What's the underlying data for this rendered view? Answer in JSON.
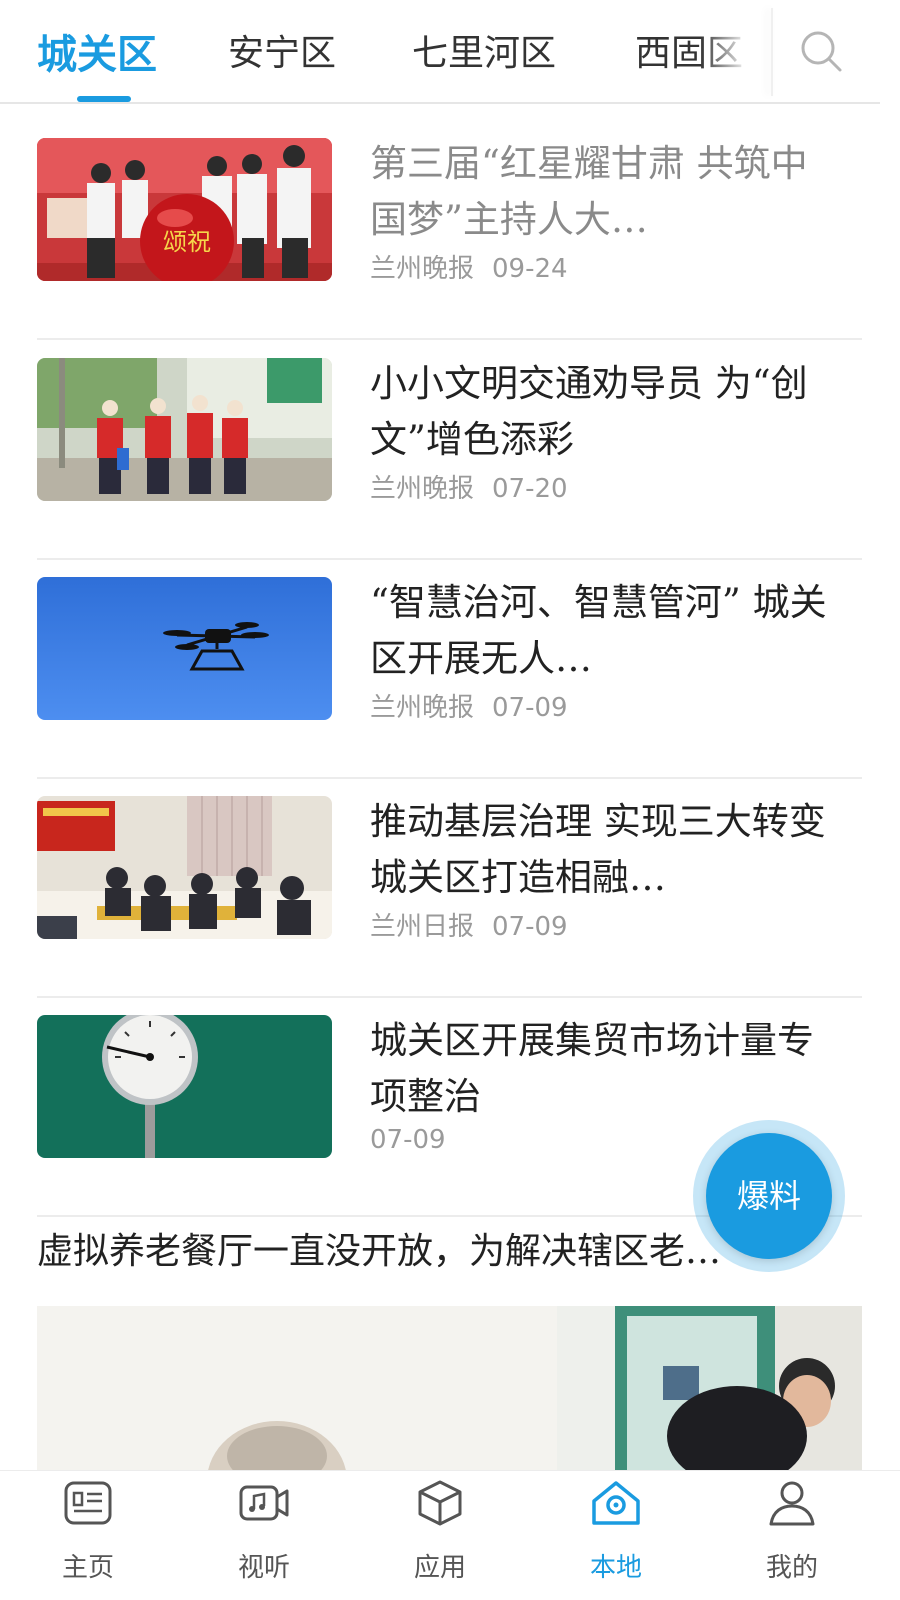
{
  "tabs": [
    {
      "label": "城关区",
      "active": true
    },
    {
      "label": "安宁区",
      "active": false
    },
    {
      "label": "七里河区",
      "active": false
    },
    {
      "label": "西固区",
      "active": false
    }
  ],
  "search": {
    "icon": "search-icon"
  },
  "news": [
    {
      "title": "第三届“红星耀甘肃 共筑中国梦”主持人大…",
      "source": "兰州晚报",
      "date": "09-24",
      "read": true,
      "image_caption": "颂祝"
    },
    {
      "title": "小小文明交通劝导员 为“创文”增色添彩",
      "source": "兰州晚报",
      "date": "07-20",
      "read": false
    },
    {
      "title": "“智慧治河、智慧管河” 城关区开展无人…",
      "source": "兰州晚报",
      "date": "07-09",
      "read": false
    },
    {
      "title": "推动基层治理 实现三大转变 城关区打造相融…",
      "source": "兰州日报",
      "date": "07-09",
      "read": false
    },
    {
      "title": "城关区开展集贸市场计量专项整治",
      "source": "",
      "date": "07-09",
      "read": false
    }
  ],
  "featured": {
    "title": "虚拟养老餐厅一直没开放，为解决辖区老…"
  },
  "fab": {
    "label": "爆料"
  },
  "bottom_nav": [
    {
      "label": "主页",
      "icon": "news-icon",
      "active": false
    },
    {
      "label": "视听",
      "icon": "video-icon",
      "active": false
    },
    {
      "label": "应用",
      "icon": "cube-icon",
      "active": false
    },
    {
      "label": "本地",
      "icon": "location-home-icon",
      "active": true
    },
    {
      "label": "我的",
      "icon": "user-icon",
      "active": false
    }
  ],
  "colors": {
    "accent": "#1a9be0",
    "text": "#222222",
    "muted": "#9a9a9a"
  }
}
